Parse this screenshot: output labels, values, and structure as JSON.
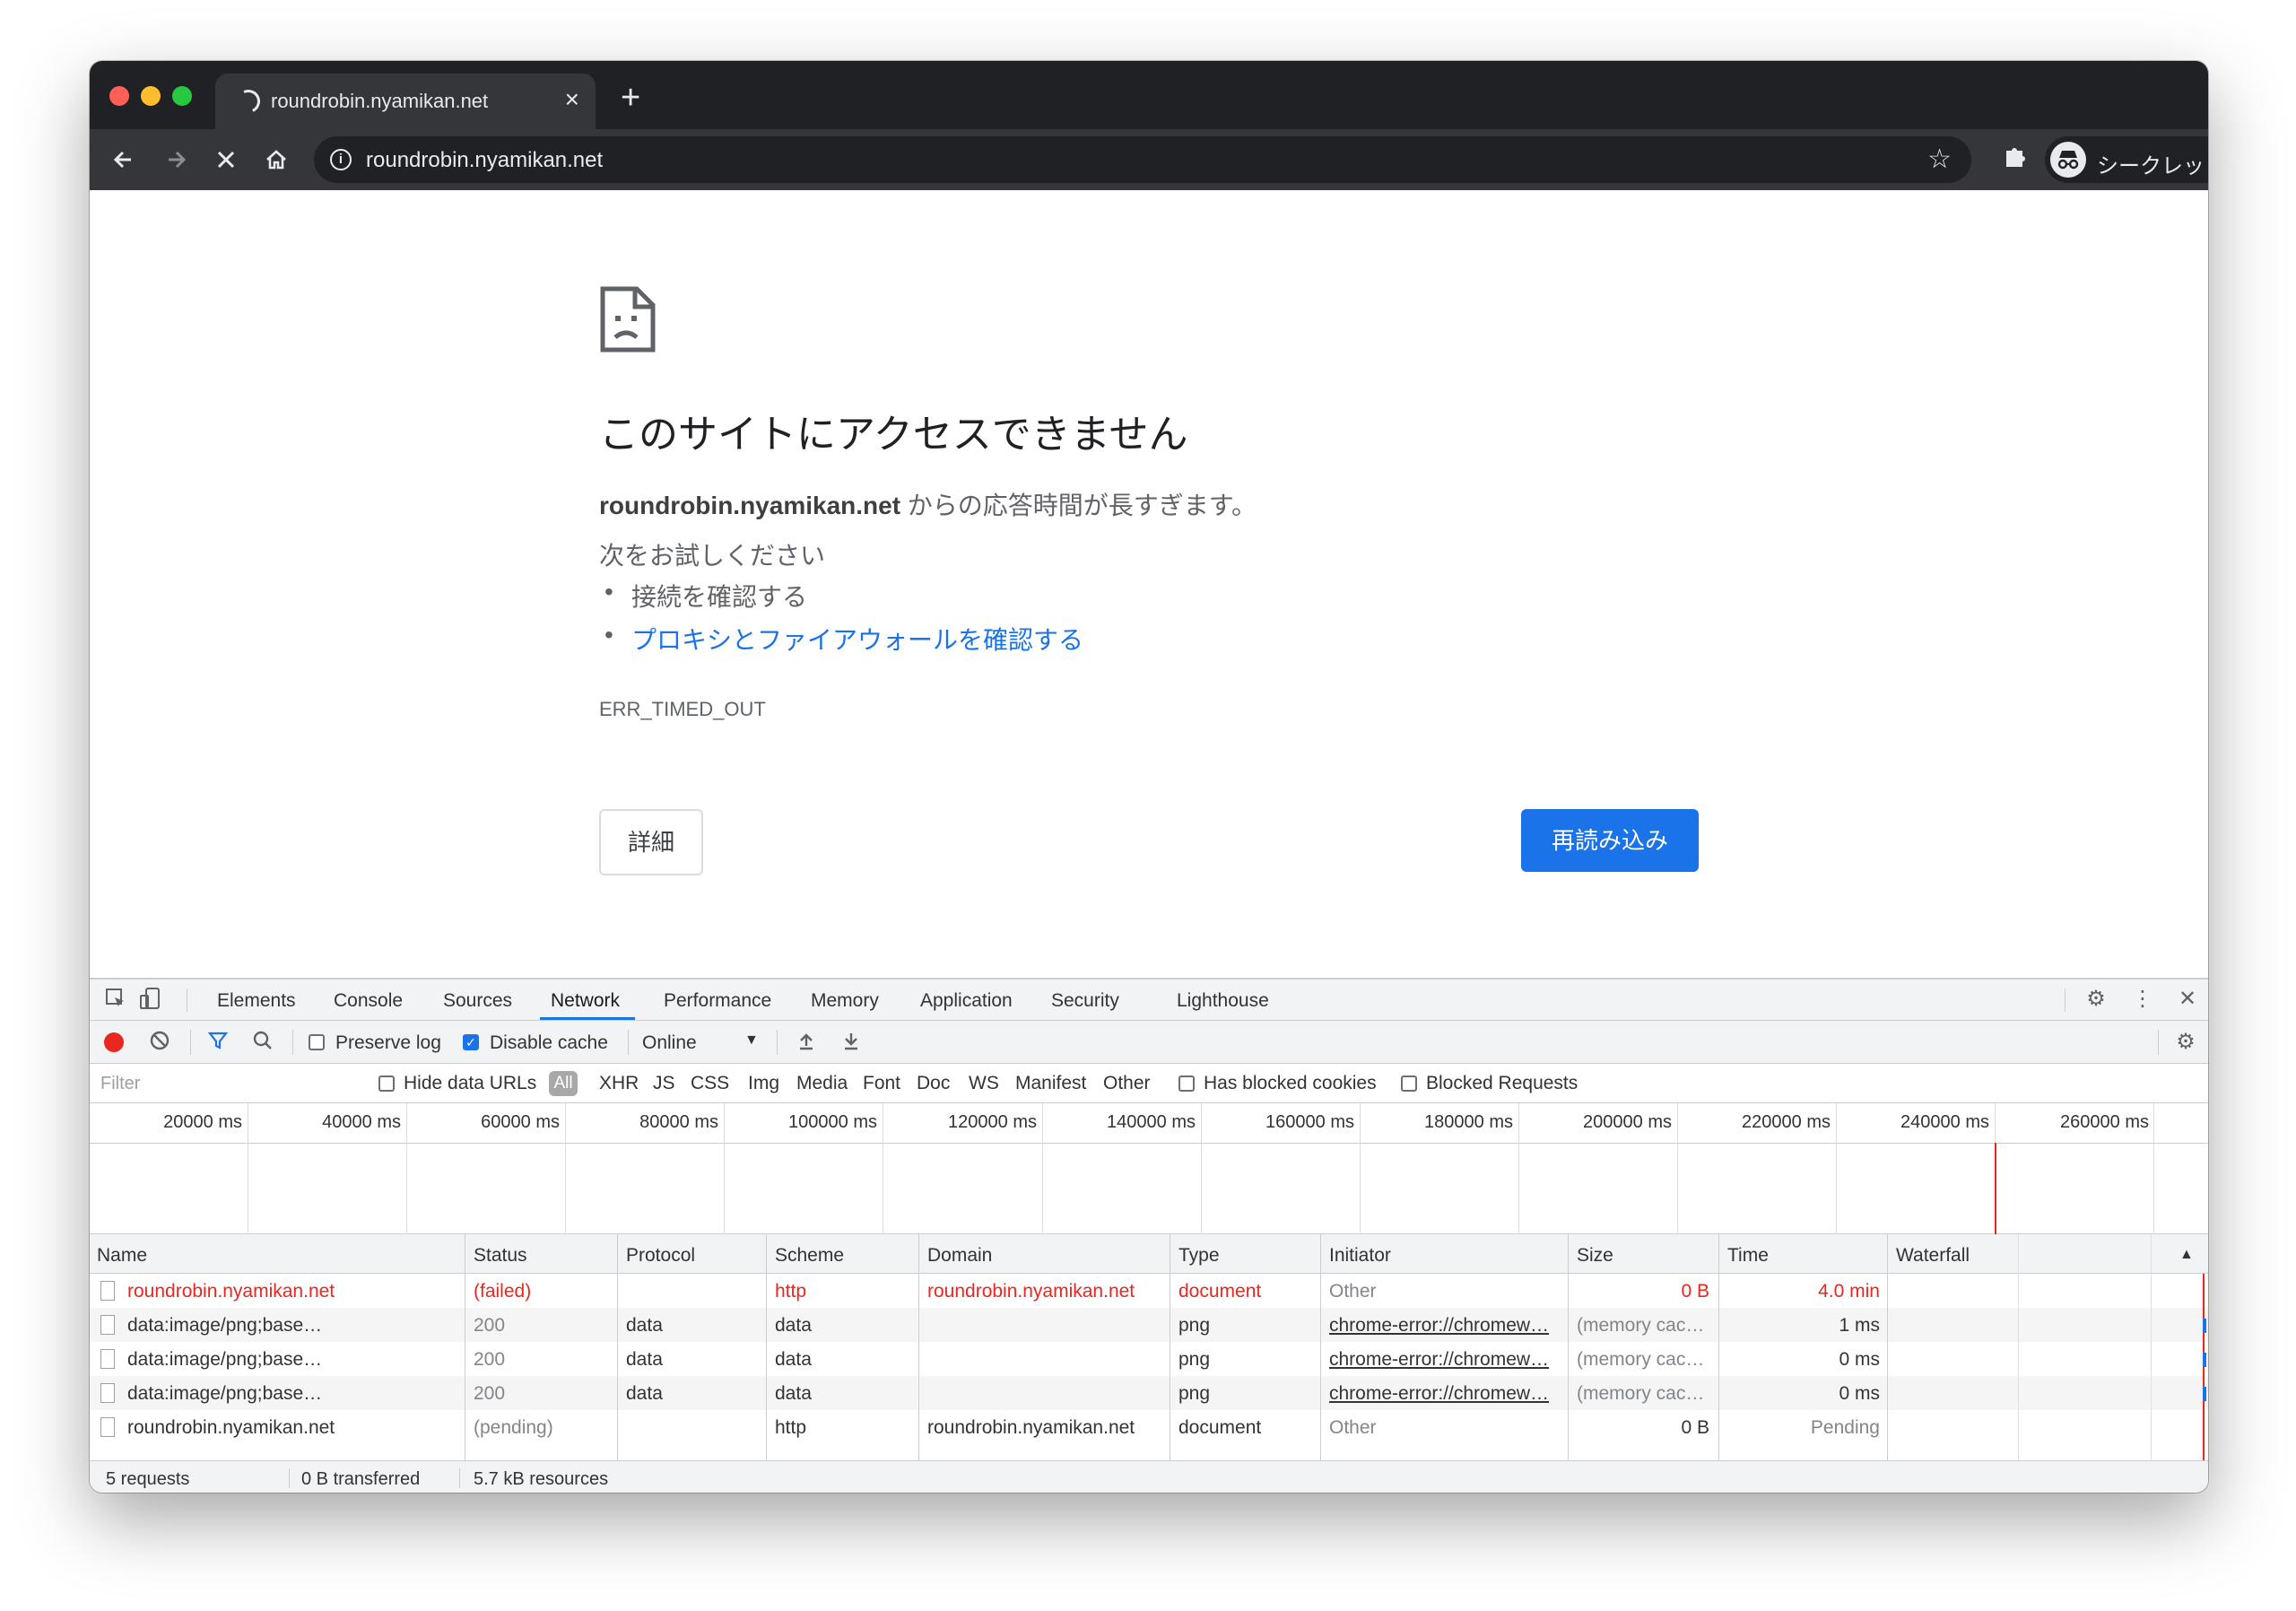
{
  "browser": {
    "tab_title": "roundrobin.nyamikan.net",
    "tab_close": "×",
    "new_tab": "+",
    "url": "roundrobin.nyamikan.net",
    "incognito_label": "シークレット",
    "icons": {
      "back": "back-arrow-icon",
      "forward": "forward-arrow-icon",
      "stop": "stop-icon",
      "home": "home-icon",
      "info": "info-icon",
      "star": "star-icon",
      "extensions": "puzzle-icon",
      "menu": "kebab-menu-icon"
    }
  },
  "error_page": {
    "title": "このサイトにアクセスできません",
    "host_bold": "roundrobin.nyamikan.net",
    "description_suffix": " からの応答時間が長すぎます。",
    "try_label": "次をお試しください",
    "suggestions": [
      "接続を確認する",
      "プロキシとファイアウォールを確認する"
    ],
    "error_code": "ERR_TIMED_OUT",
    "details_button": "詳細",
    "reload_button": "再読み込み"
  },
  "devtools": {
    "tabs": [
      "Elements",
      "Console",
      "Sources",
      "Network",
      "Performance",
      "Memory",
      "Application",
      "Security",
      "Lighthouse"
    ],
    "active_tab": "Network",
    "toolbar": {
      "preserve_log": "Preserve log",
      "preserve_log_checked": false,
      "disable_cache": "Disable cache",
      "disable_cache_checked": true,
      "throttle": "Online"
    },
    "filter": {
      "placeholder": "Filter",
      "hide_data_urls": "Hide data URLs",
      "types": [
        "All",
        "XHR",
        "JS",
        "CSS",
        "Img",
        "Media",
        "Font",
        "Doc",
        "WS",
        "Manifest",
        "Other"
      ],
      "has_blocked_cookies": "Has blocked cookies",
      "blocked_requests": "Blocked Requests"
    },
    "overview_ticks": [
      "20000 ms",
      "40000 ms",
      "60000 ms",
      "80000 ms",
      "100000 ms",
      "120000 ms",
      "140000 ms",
      "160000 ms",
      "180000 ms",
      "200000 ms",
      "220000 ms",
      "240000 ms",
      "260000 ms"
    ],
    "columns": [
      "Name",
      "Status",
      "Protocol",
      "Scheme",
      "Domain",
      "Type",
      "Initiator",
      "Size",
      "Time",
      "Waterfall"
    ],
    "rows": [
      {
        "name": "roundrobin.nyamikan.net",
        "status": "(failed)",
        "protocol": "",
        "scheme": "http",
        "domain": "roundrobin.nyamikan.net",
        "type": "document",
        "initiator": "Other",
        "size": "0 B",
        "time": "4.0 min"
      },
      {
        "name": "data:image/png;base…",
        "status": "200",
        "protocol": "data",
        "scheme": "data",
        "domain": "",
        "type": "png",
        "initiator": "chrome-error://chromew…",
        "size": "(memory cac…",
        "time": "1 ms"
      },
      {
        "name": "data:image/png;base…",
        "status": "200",
        "protocol": "data",
        "scheme": "data",
        "domain": "",
        "type": "png",
        "initiator": "chrome-error://chromew…",
        "size": "(memory cac…",
        "time": "0 ms"
      },
      {
        "name": "data:image/png;base…",
        "status": "200",
        "protocol": "data",
        "scheme": "data",
        "domain": "",
        "type": "png",
        "initiator": "chrome-error://chromew…",
        "size": "(memory cac…",
        "time": "0 ms"
      },
      {
        "name": "roundrobin.nyamikan.net",
        "status": "(pending)",
        "protocol": "",
        "scheme": "http",
        "domain": "roundrobin.nyamikan.net",
        "type": "document",
        "initiator": "Other",
        "size": "0 B",
        "time": "Pending"
      }
    ],
    "status_bar": {
      "requests": "5 requests",
      "transferred": "0 B transferred",
      "resources": "5.7 kB resources"
    },
    "colors": {
      "error": "#e8271f",
      "accent": "#1a73e8"
    }
  }
}
